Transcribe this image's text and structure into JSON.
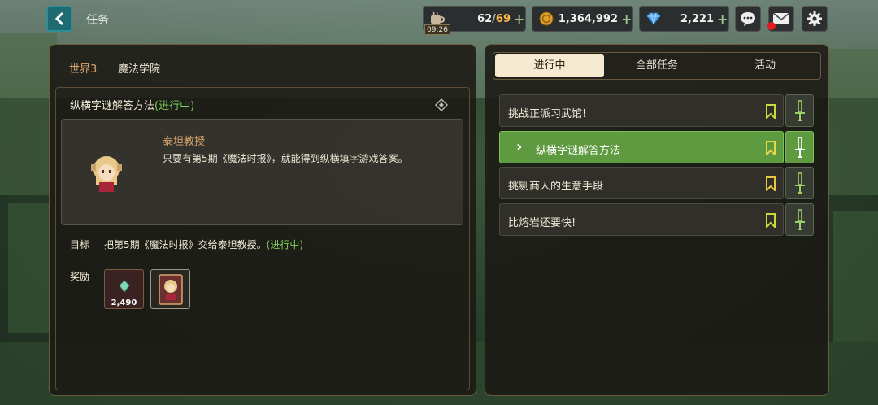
{
  "header": {
    "title": "任务",
    "stamina": {
      "current": "62",
      "max": "69",
      "timer": "09:26"
    },
    "coins": "1,364,992",
    "gems": "2,221"
  },
  "left_panel": {
    "breadcrumb": {
      "world": "世界3",
      "area": "魔法学院"
    },
    "quest": {
      "title": "纵横字谜解答方法",
      "status": "(进行中)"
    },
    "npc": {
      "name": "泰坦教授",
      "dialogue": "只要有第5期《魔法时报》，就能得到纵横填字游戏答案。"
    },
    "goal": {
      "label": "目标",
      "text": "把第5期《魔法时报》交给泰坦教授。",
      "status": "(进行中)"
    },
    "rewards": {
      "label": "奖励",
      "gem_amount": "2,490"
    }
  },
  "right_panel": {
    "tabs": [
      {
        "label": "进行中",
        "active": true
      },
      {
        "label": "全部任务",
        "active": false
      },
      {
        "label": "活动",
        "active": false
      }
    ],
    "quests": [
      {
        "label": "挑战正派习武馆!",
        "selected": false
      },
      {
        "label": "纵横字谜解答方法",
        "selected": true
      },
      {
        "label": "挑剔商人的生意手段",
        "selected": false
      },
      {
        "label": "比熔岩还要快!",
        "selected": false
      }
    ]
  },
  "colors": {
    "accent_green": "#7fcf5b",
    "selected_row": "#5e9a3f",
    "tab_active": "#f5e9cf",
    "npc_name": "#d9a46a"
  }
}
